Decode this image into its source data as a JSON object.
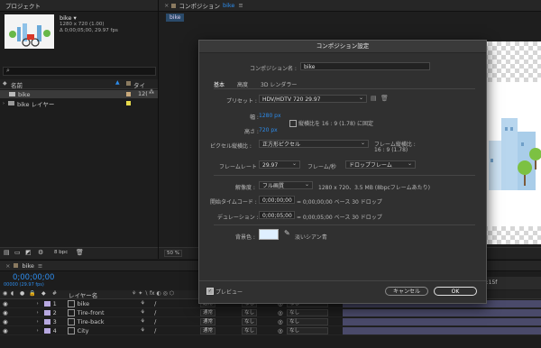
{
  "project": {
    "tab": "プロジェクト",
    "item_name": "bike ▾",
    "item_info1": "1280 x 720 (1.00)",
    "item_info2": "Δ 0;00;05;00, 29.97 fps",
    "search_placeholder": "",
    "col_name": "名前",
    "col_type": "タイ",
    "rows": [
      {
        "label": "bike",
        "tail": "12(",
        "selected": true
      },
      {
        "label": "bike レイヤー",
        "tail": "",
        "selected": false
      }
    ],
    "bpc": "8 bpc"
  },
  "viewer": {
    "tab_label": "コンポジション",
    "tab_comp": "bike",
    "subtab": "bike",
    "zoom": "50 %",
    "time_label": "12:15f"
  },
  "timeline": {
    "comp_tab": "bike",
    "timecode": "0;00;00;00",
    "fps_line": "00000 (29.97 fps)",
    "col_header": "レイヤー名",
    "layers": [
      {
        "num": "1",
        "name": "bike",
        "mode": "通常",
        "none": "なし"
      },
      {
        "num": "2",
        "name": "Tire-front",
        "mode": "通常",
        "none": "なし"
      },
      {
        "num": "3",
        "name": "Tire-back",
        "mode": "通常",
        "none": "なし"
      },
      {
        "num": "4",
        "name": "City",
        "mode": "通常",
        "none": "なし"
      }
    ]
  },
  "dialog": {
    "title": "コンポジション設定",
    "name_label": "コンポジション名 :",
    "name_value": "bike",
    "tabs": [
      "基本",
      "高度",
      "3D レンダラー"
    ],
    "preset_label": "プリセット :",
    "preset_value": "HDV/HDTV 720 29.97",
    "width_label": "幅 :",
    "width_value": "1280 px",
    "lock_label": "縦横比を 16 : 9 (1.78) に固定",
    "height_label": "高さ :",
    "height_value": "720 px",
    "par_label": "ピクセル縦横比 :",
    "par_value": "正方形ピクセル",
    "frame_aspect_label": "フレーム縦横比 :",
    "frame_aspect_value": "16 : 9 (1.78)",
    "fps_label": "フレームレート :",
    "fps_value": "29.97",
    "fps_unit": "フレーム/秒",
    "drop_value": "ドロップフレーム",
    "res_label": "解像度 :",
    "res_value": "フル画質",
    "res_info": "1280 x 720、3.5 MB (8bpcフレームあたり)",
    "start_label": "開始タイムコード :",
    "start_value": "0;00;00;00",
    "start_info": "= 0;00;00;00 ベース 30 ドロップ",
    "dur_label": "デュレーション :",
    "dur_value": "0;00;05;00",
    "dur_info": "= 0;00;05;00 ベース 30 ドロップ",
    "bg_label": "背景色 :",
    "bg_color": "#dff0ff",
    "bg_name": "淡いシアン青",
    "preview_label": "プレビュー",
    "cancel_label": "キャンセル",
    "ok_label": "OK"
  },
  "colors": {
    "accent": "#2d8ceb",
    "layer_swatch": "#b7a8e0"
  }
}
